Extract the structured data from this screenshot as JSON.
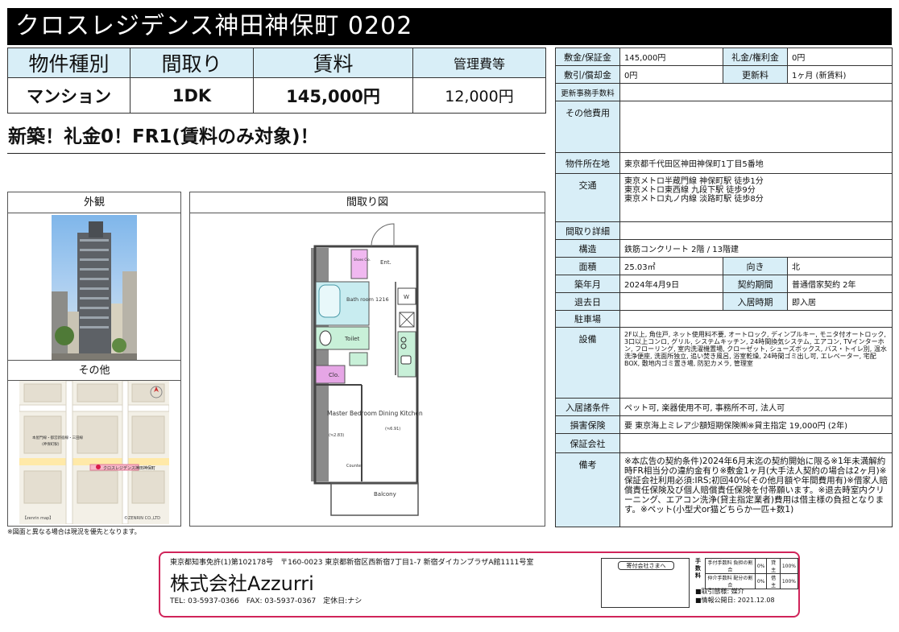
{
  "title": "クロスレジデンス神田神保町 0202",
  "summary": {
    "headers": [
      "物件種別",
      "間取り",
      "賃料",
      "管理費等"
    ],
    "values": [
      "マンション",
      "1DK",
      "145,000円",
      "12,000円"
    ]
  },
  "catch_copy": "新築！礼金0！FR1(賃料のみ対象)！",
  "panels": {
    "exterior": "外観",
    "other": "その他",
    "floorplan": "間取り図",
    "footnote": "※図面と異なる場合は現況を優先となります。"
  },
  "map": {
    "label_building": "クロスレジデンス神田神保町",
    "label_office": "本屋門線・都営新宿線・三田線",
    "label_station": "(神保町駅)",
    "caption_left": "【zenrin map】",
    "caption_right": "©ZENRIN CO.,LTD"
  },
  "floorplan": {
    "ent": "Ent.",
    "bath": "Bath room 1216",
    "toilet": "Toilet",
    "clo": "Clo.",
    "shoes": "Shoes Clo.",
    "w": "W",
    "master": "Master Bedroom",
    "master_size": "(≒2.83)",
    "dining": "Dining Kitchen",
    "dining_size": "(≒6.91)",
    "counter": "Counter",
    "balcony": "Balcony"
  },
  "details": {
    "deposit_label": "敷金/保証金",
    "deposit": "145,000円",
    "keymoney_label": "礼金/権利金",
    "keymoney": "0円",
    "shikibiki_label": "敷引/償却金",
    "shikibiki": "0円",
    "renewal_label": "更新料",
    "renewal": "1ヶ月 (新賃料)",
    "renewal_fee_label": "更新事務手数料",
    "renewal_fee": "",
    "other_cost_label": "その他費用",
    "other_cost": "",
    "address_label": "物件所在地",
    "address": "東京都千代田区神田神保町1丁目5番地",
    "access_label": "交通",
    "access": [
      "東京メトロ半蔵門線 神保町駅 徒歩1分",
      "東京メトロ東西線 九段下駅 徒歩9分",
      "東京メトロ丸ノ内線 淡路町駅 徒歩8分"
    ],
    "layout_detail_label": "間取り詳細",
    "layout_detail": "",
    "structure_label": "構造",
    "structure": "鉄筋コンクリート 2階 / 13階建",
    "area_label": "面積",
    "area": "25.03㎡",
    "direction_label": "向き",
    "direction": "北",
    "built_label": "築年月",
    "built": "2024年4月9日",
    "contract_label": "契約期間",
    "contract": "普通借家契約 2年",
    "moveout_label": "退去日",
    "moveout": "",
    "movein_label": "入居時期",
    "movein": "即入居",
    "parking_label": "駐車場",
    "parking": "",
    "facilities_label": "設備",
    "facilities": "2F以上, 角住戸, ネット使用料不要, オートロック, ディンプルキー, モニタ付オートロック, 3口以上コンロ, グリル, システムキッチン, 24時間換気システム, エアコン, TVインターホン, フローリング, 室内洗濯機置場, クローゼット, シューズボックス, バス・トイレ別, 温水洗浄便座, 洗面所独立, 追い焚き風呂, 浴室乾燥, 24時間ゴミ出し可, エレベーター, 宅配BOX, 敷地内ゴミ置き場, 防犯カメラ, 管理室",
    "conditions_label": "入居諸条件",
    "conditions": "ペット可, 楽器使用不可, 事務所不可, 法人可",
    "insurance_label": "損害保険",
    "insurance": "要 東京海上ミレア少額短期保険㈱※貸主指定 19,000円 (2年)",
    "guarantor_label": "保証会社",
    "guarantor": "",
    "remarks_label": "備考",
    "remarks": "※本広告の契約条件)2024年6月末迄の契約開始に限る※1年未満解約時FR相当分の違約金有り※敷金1ヶ月(大手法人契約の場合は2ヶ月)※保証会社利用必須:IRS;初回40%(その他月額や年間費用有)※借家人賠償責任保険及び個人賠償責任保険を付帯願います。※退去時室内クリーニング、エアコン洗浄(貸主指定業者)費用は借主様の負担となります。※ペット(小型犬or猫どちらか一匹+数1)"
  },
  "footer": {
    "license": "東京都知事免許(1)第102178号　〒160-0023 東京都新宿区西新宿7丁目1-7 新宿ダイカンプラザA館1111号室",
    "company": "株式会社Azzurri",
    "contact": "TEL: 03-5937-0366　FAX: 03-5937-0367　定休日:ナシ",
    "stamp_label": "寄付会社さまへ",
    "deal_label": "手数料",
    "fee_rows": [
      [
        "手付手数料 負担の割合",
        "0%",
        "貸主",
        "100%"
      ],
      [
        "仲介手数料 配分の割合",
        "0%",
        "借主",
        "100%"
      ]
    ],
    "deal_type": "■取引態様: 媒介",
    "info_date": "■情報公開日: 2021.12.08"
  }
}
